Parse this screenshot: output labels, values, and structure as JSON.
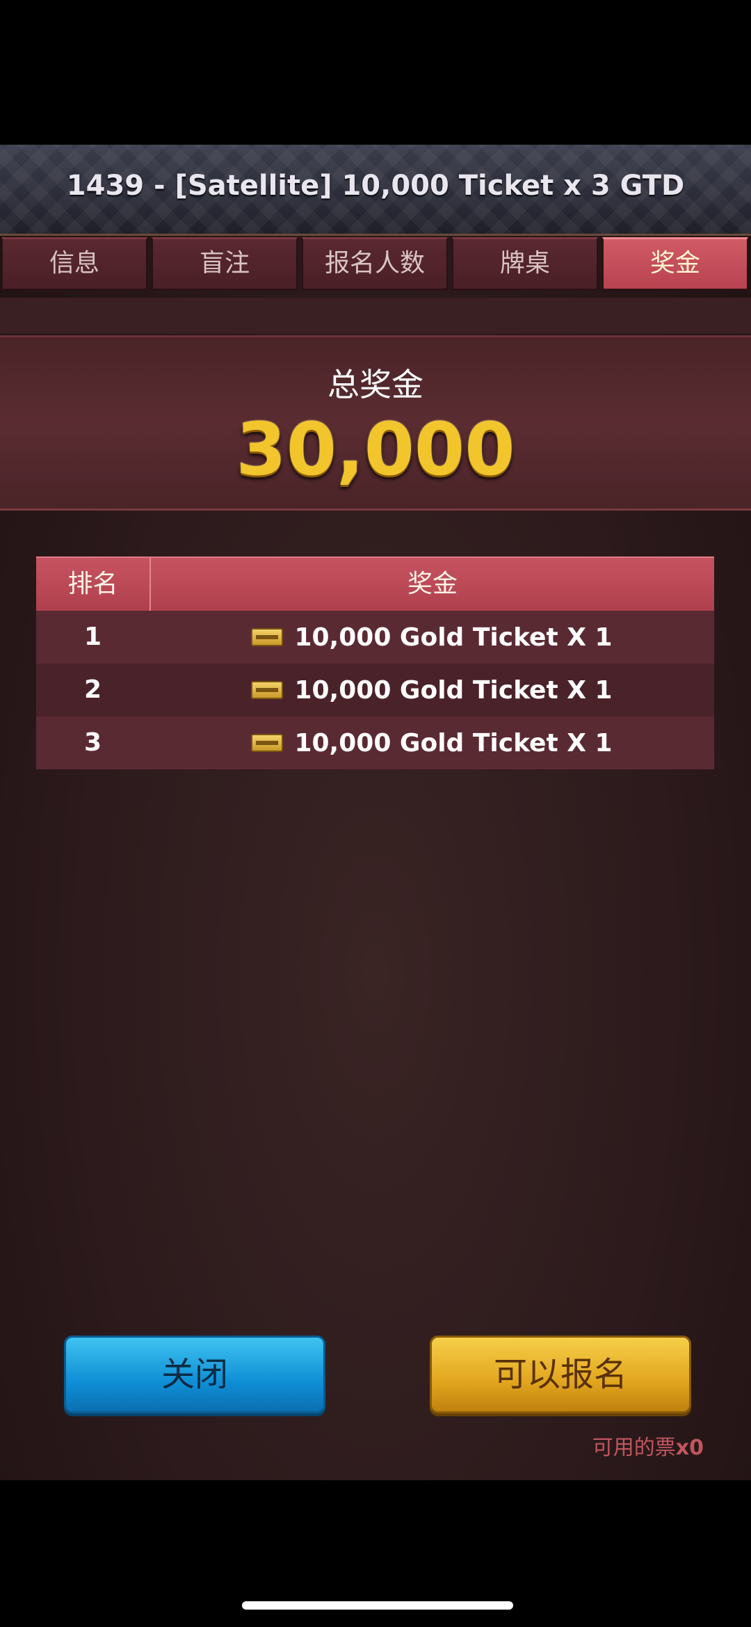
{
  "header": {
    "title": "1439 - [Satellite] 10,000 Ticket x 3 GTD"
  },
  "tabs": [
    {
      "label": "信息",
      "active": false
    },
    {
      "label": "盲注",
      "active": false
    },
    {
      "label": "报名人数",
      "active": false
    },
    {
      "label": "牌桌",
      "active": false
    },
    {
      "label": "奖金",
      "active": true
    }
  ],
  "prize_pool": {
    "label": "总奖金",
    "amount": "30,000"
  },
  "payout_table": {
    "columns": [
      "排名",
      "奖金"
    ],
    "rows": [
      {
        "rank": "1",
        "prize": "10,000 Gold Ticket X 1",
        "icon": "ticket-icon"
      },
      {
        "rank": "2",
        "prize": "10,000 Gold Ticket X 1",
        "icon": "ticket-icon"
      },
      {
        "rank": "3",
        "prize": "10,000 Gold Ticket X 1",
        "icon": "ticket-icon"
      }
    ]
  },
  "buttons": {
    "close": "关闭",
    "register": "可以报名"
  },
  "tickets": {
    "label": "可用的票",
    "count": "x0"
  },
  "colors": {
    "accent_red": "#b8424f",
    "gold": "#f2c52c",
    "button_blue": "#0f8fd6",
    "button_gold": "#e2a51e"
  }
}
